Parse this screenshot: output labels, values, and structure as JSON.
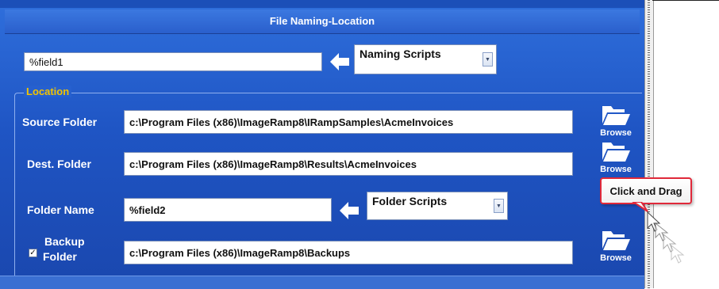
{
  "panel": {
    "title": "File Naming-Location"
  },
  "naming": {
    "field_value": "%field1",
    "scripts_combo": "Naming Scripts"
  },
  "location": {
    "group_title": "Location",
    "source_label": "Source Folder",
    "source_value": "c:\\Program Files (x86)\\ImageRamp8\\IRampSamples\\AcmeInvoices",
    "dest_label": "Dest. Folder",
    "dest_value": "c:\\Program Files (x86)\\ImageRamp8\\Results\\AcmeInvoices",
    "folder_name_label": "Folder Name",
    "folder_name_value": "%field2",
    "folder_scripts_combo": "Folder Scripts",
    "backup_label_line1": "Backup",
    "backup_label_line2": "Folder",
    "backup_checked": true,
    "backup_value": "c:\\Program Files (x86)\\ImageRamp8\\Backups",
    "browse_label": "Browse",
    "browse_label_obscured": "Browse"
  },
  "tooltip": {
    "text": "Click and Drag"
  },
  "colors": {
    "panel": "#2660cf",
    "group_title": "#f2c400",
    "tooltip_border": "#e0293a"
  },
  "icons": [
    "folder-open-icon",
    "left-arrow-icon",
    "checkbox-checked-icon",
    "cursor-icon"
  ]
}
